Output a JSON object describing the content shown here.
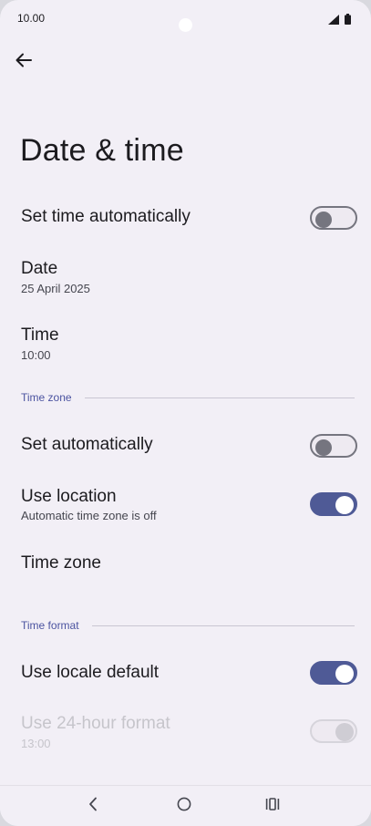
{
  "status_bar": {
    "time": "10.00",
    "icons": [
      "signal-icon",
      "battery-icon"
    ]
  },
  "header": {
    "back_icon": "arrow-left-icon",
    "title": "Date & time"
  },
  "settings": {
    "set_time_automatically": {
      "title": "Set time automatically",
      "enabled": false
    },
    "date": {
      "title": "Date",
      "value": "25 April 2025"
    },
    "time": {
      "title": "Time",
      "value": "10:00"
    },
    "time_zone_section": {
      "label": "Time zone"
    },
    "set_automatically": {
      "title": "Set automatically",
      "enabled": false
    },
    "use_location": {
      "title": "Use location",
      "subtitle": "Automatic time zone is off",
      "enabled": true
    },
    "time_zone": {
      "title": "Time zone"
    },
    "time_format_section": {
      "label": "Time format"
    },
    "use_locale_default": {
      "title": "Use locale default",
      "enabled": true
    },
    "use_24_hour": {
      "title": "Use 24-hour format",
      "subtitle": "13:00",
      "enabled": true,
      "disabled": true
    }
  },
  "nav_bar": {
    "buttons": [
      "back-nav-icon",
      "home-nav-icon",
      "recents-nav-icon"
    ]
  },
  "colors": {
    "background": "#f2eff6",
    "accent": "#4f5a96",
    "section_label": "#4b53a0",
    "text_primary": "#1c1b1f",
    "text_disabled": "#c6c5cb"
  }
}
